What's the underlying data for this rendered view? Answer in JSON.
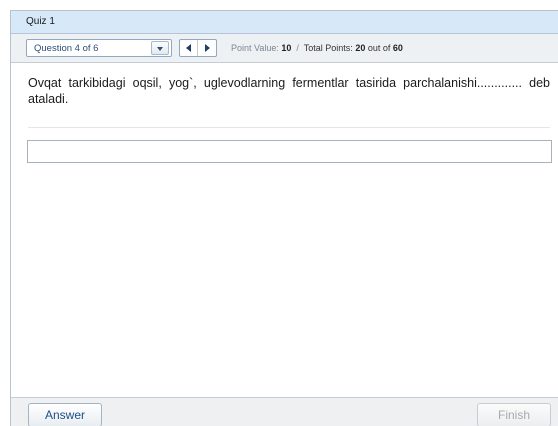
{
  "window": {
    "title": "Quiz 1"
  },
  "toolbar": {
    "question_select": "Question 4 of 6",
    "point_value_label": "Point Value:",
    "point_value": "10",
    "separator": "/",
    "total_points_label": "Total Points:",
    "total_points": "20",
    "out_of_label": "out of",
    "max_points": "60"
  },
  "question": {
    "text": "Ovqat tarkibidagi oqsil, yog`, uglevodlarning fermentlar tasirida parchalanishi............. deb ataladi."
  },
  "answer_field": {
    "value": "",
    "placeholder": ""
  },
  "footer": {
    "answer_label": "Answer",
    "finish_label": "Finish"
  },
  "icons": {
    "dropdown": "chevron-down-icon",
    "prev": "triangle-left-icon",
    "next": "triangle-right-icon"
  },
  "colors": {
    "titlebar_bg": "#d7e8f9",
    "toolbar_bg": "#eef1f4",
    "accent_text": "#1e4f86"
  }
}
